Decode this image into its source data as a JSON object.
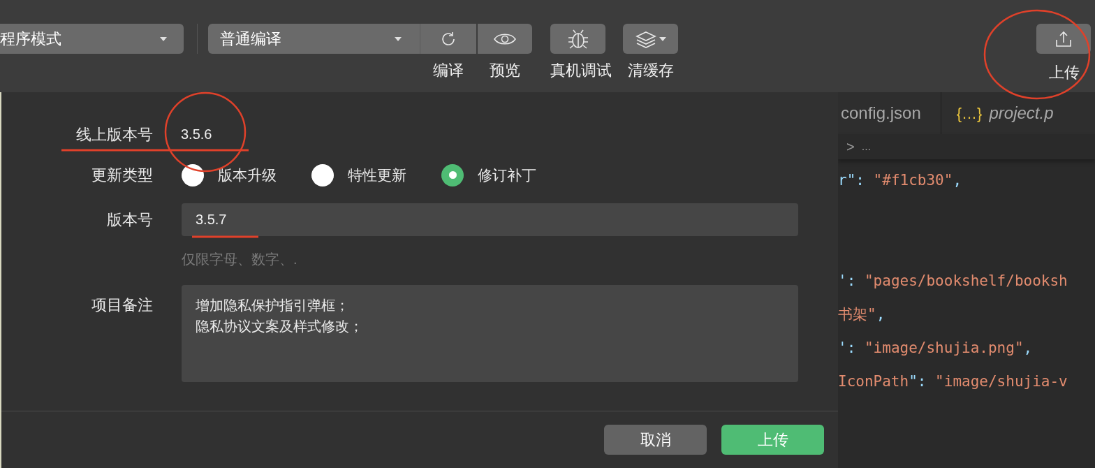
{
  "toolbar": {
    "mode_select": {
      "value": "程序模式"
    },
    "compile_select": {
      "value": "普通编译"
    },
    "tools": [
      {
        "kind": "compile",
        "label": "编译"
      },
      {
        "kind": "preview",
        "label": "预览"
      },
      {
        "kind": "debug",
        "label": "真机调试"
      },
      {
        "kind": "cache",
        "label": "清缓存"
      }
    ],
    "upload": {
      "label": "上传"
    }
  },
  "editor": {
    "tabs": [
      {
        "label": "config.json",
        "kind": "plain",
        "selected": false
      },
      {
        "label": "project.p",
        "kind": "json",
        "icon_text": "{…}",
        "selected": false
      }
    ],
    "breadcrumb": {
      "separator": ">",
      "text": "..."
    },
    "blocks": [
      [
        [
          {
            "kind": "key",
            "text": "r\""
          },
          {
            "kind": "punct",
            "text": ": "
          },
          {
            "kind": "string",
            "text": "\"#f1cb30\""
          },
          {
            "kind": "punct",
            "text": ","
          }
        ]
      ],
      [
        [
          {
            "kind": "key",
            "text": "'"
          },
          {
            "kind": "punct",
            "text": ": "
          },
          {
            "kind": "string",
            "text": "\"pages/bookshelf/booksh"
          }
        ],
        [
          {
            "kind": "string",
            "text": "书架\""
          },
          {
            "kind": "punct",
            "text": ","
          }
        ],
        [
          {
            "kind": "key",
            "text": "'"
          },
          {
            "kind": "punct",
            "text": ": "
          },
          {
            "kind": "string",
            "text": "\"image/shujia.png\""
          },
          {
            "kind": "punct",
            "text": ","
          }
        ],
        [
          {
            "kind": "string",
            "text": "IconPath"
          },
          {
            "kind": "key",
            "text": "\""
          },
          {
            "kind": "punct",
            "text": ": "
          },
          {
            "kind": "string",
            "text": "\"image/shujia-v"
          }
        ]
      ]
    ]
  },
  "dialog": {
    "online_version": {
      "label": "线上版本号",
      "value": "3.5.6"
    },
    "update_type": {
      "label": "更新类型",
      "options": [
        {
          "label": "版本升级",
          "selected": false
        },
        {
          "label": "特性更新",
          "selected": false
        },
        {
          "label": "修订补丁",
          "selected": true
        }
      ]
    },
    "version": {
      "label": "版本号",
      "value": "3.5.7",
      "hint": "仅限字母、数字、."
    },
    "notes": {
      "label": "项目备注",
      "lines": [
        "增加隐私保护指引弹框；",
        "隐私协议文案及样式修改；"
      ]
    },
    "buttons": [
      {
        "label": "取消",
        "kind": "secondary"
      },
      {
        "label": "上传",
        "kind": "primary"
      }
    ]
  }
}
